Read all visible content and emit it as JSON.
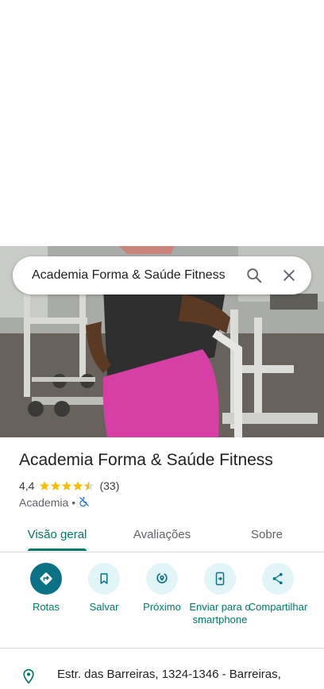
{
  "search": {
    "query": "Academia Forma & Saúde Fitness"
  },
  "place": {
    "title": "Academia Forma & Saúde Fitness",
    "rating": "4,4",
    "rating_value": 4.4,
    "review_count": "(33)",
    "category": "Academia",
    "separator": "•"
  },
  "tabs": [
    {
      "label": "Visão geral",
      "active": true
    },
    {
      "label": "Avaliações",
      "active": false
    },
    {
      "label": "Sobre",
      "active": false
    }
  ],
  "actions": [
    {
      "label": "Rotas",
      "icon": "directions-icon"
    },
    {
      "label": "Salvar",
      "icon": "bookmark-icon"
    },
    {
      "label": "Próximo",
      "icon": "nearby-icon"
    },
    {
      "label": "Enviar para o smartphone",
      "icon": "send-to-phone-icon"
    },
    {
      "label": "Compartilhar",
      "icon": "share-icon"
    }
  ],
  "address": {
    "text": "Estr. das Barreiras, 1324-1346 - Barreiras,"
  },
  "colors": {
    "accent": "#00796b",
    "primary_button": "#0b7285",
    "button_bg": "#e1f4f7",
    "star": "#fbbc04",
    "wheelchair_blue": "#1a73e8"
  }
}
